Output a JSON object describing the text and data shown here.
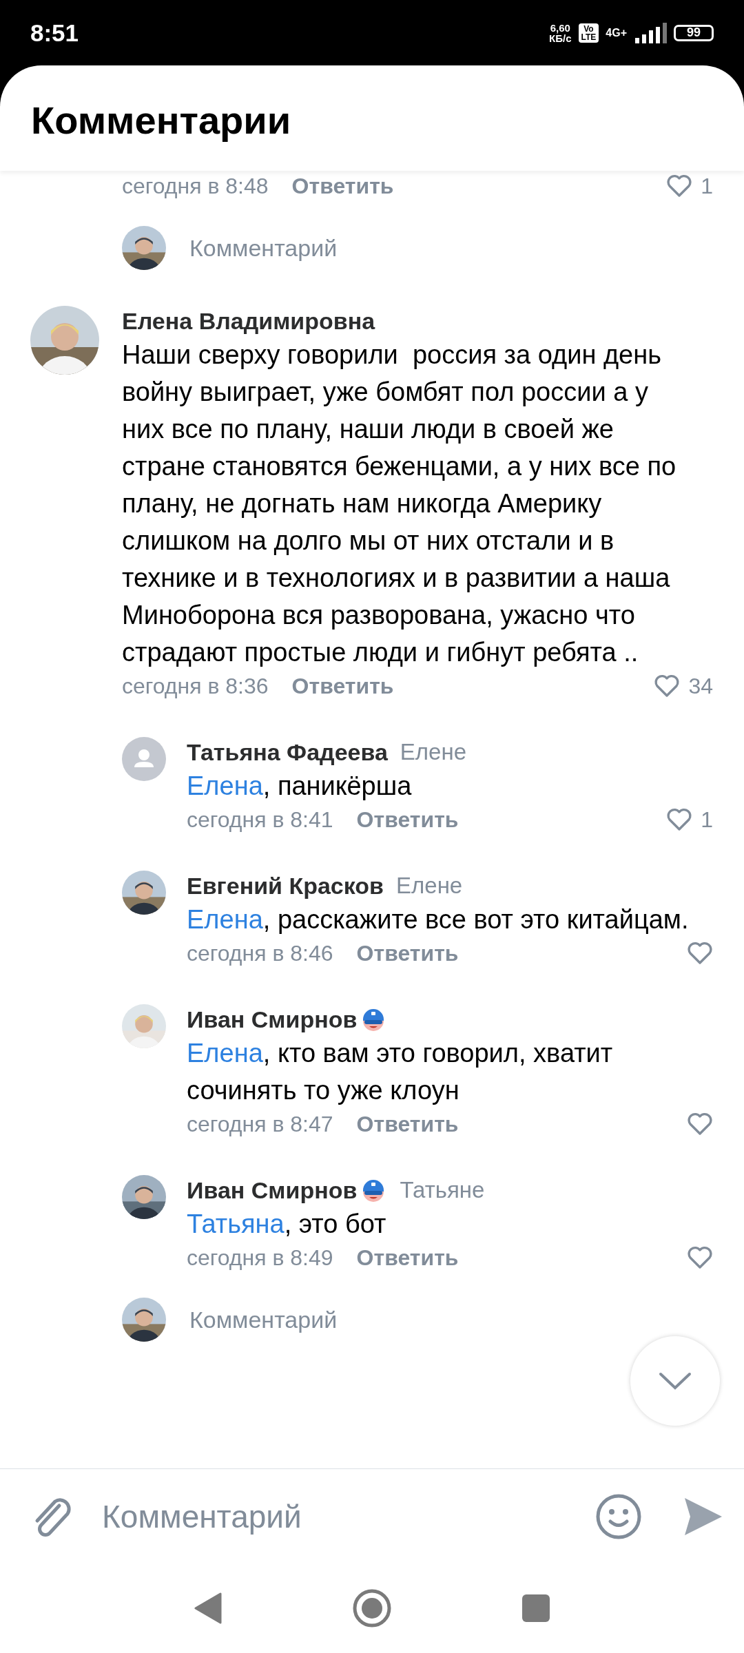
{
  "status_bar": {
    "time": "8:51",
    "speed_value": "6,60",
    "speed_unit": "КБ/с",
    "volte_top": "Vo",
    "volte_bottom": "LTE",
    "network": "4G+",
    "battery": "99"
  },
  "header": {
    "title": "Комментарии"
  },
  "items": [
    {
      "kind": "meta_only",
      "time": "сегодня в 8:48",
      "reply_label": "Ответить",
      "likes": "1"
    },
    {
      "kind": "prompt",
      "placeholder": "Комментарий"
    },
    {
      "kind": "comment",
      "default_avatar": false,
      "author": "Елена Владимировна",
      "text": "Наши сверху говорили  россия за один день войну выиграет, уже бомбят пол россии а у них все по плану, наши люди в своей же стране становятся беженцами, а у них все по плану, не догнать нам никогда Америку слишком на долго мы от них отстали и в технике и в технологиях и в развитии а наша Миноборона вся разворована, ужасно что страдают простые люди и гибнут ребята ..",
      "time": "сегодня в 8:36",
      "reply_label": "Ответить",
      "likes": "34"
    },
    {
      "kind": "reply",
      "default_avatar": true,
      "author": "Татьяна Фадеева",
      "badge": false,
      "to": "Елене",
      "mention": "Елена",
      "text": ", паникёрша",
      "time": "сегодня в 8:41",
      "reply_label": "Ответить",
      "likes": "1"
    },
    {
      "kind": "reply",
      "default_avatar": false,
      "author": "Евгений Красков",
      "badge": false,
      "to": "Елене",
      "mention": "Елена",
      "text": ", расскажите все вот это китайцам.",
      "time": "сегодня в 8:46",
      "reply_label": "Ответить"
    },
    {
      "kind": "reply",
      "default_avatar": false,
      "author": "Иван Смирнов",
      "badge": true,
      "mention": "Елена",
      "text": ", кто вам это говорил, хватит сочинять то уже клоун",
      "time": "сегодня в 8:47",
      "reply_label": "Ответить"
    },
    {
      "kind": "reply",
      "default_avatar": false,
      "author": "Иван Смирнов",
      "badge": true,
      "to": "Татьяне",
      "mention": "Татьяна",
      "text": ", это бот",
      "time": "сегодня в 8:49",
      "reply_label": "Ответить"
    },
    {
      "kind": "prompt",
      "placeholder": "Комментарий"
    }
  ],
  "composer": {
    "placeholder": "Комментарий"
  }
}
